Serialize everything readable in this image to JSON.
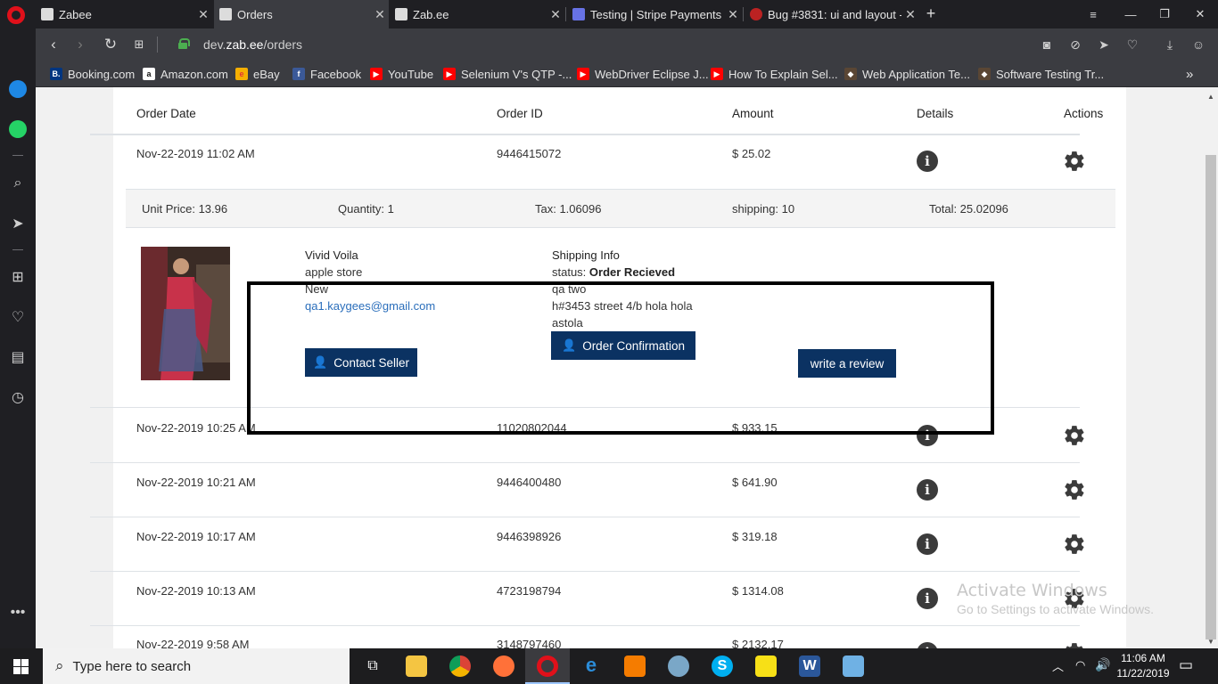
{
  "browser": {
    "tabs": [
      {
        "title": "Zabee",
        "active": false
      },
      {
        "title": "Orders",
        "active": true
      },
      {
        "title": "Zab.ee",
        "active": false
      },
      {
        "title": "Testing | Stripe Payments",
        "active": false
      },
      {
        "title": "Bug #3831: ui and layout -",
        "active": false
      }
    ],
    "new_tab": "+",
    "url_prefix": "dev.",
    "url_domain": "zab.ee",
    "url_path": "/orders",
    "bookmarks": [
      {
        "label": "Booking.com",
        "icon": "B.",
        "color": "#003580"
      },
      {
        "label": "Amazon.com",
        "icon": "a",
        "color": "#111111"
      },
      {
        "label": "eBay",
        "icon": "e",
        "color": "#e53238"
      },
      {
        "label": "Facebook",
        "icon": "f",
        "color": "#3b5998"
      },
      {
        "label": "YouTube",
        "icon": "▶",
        "color": "#ff0000"
      },
      {
        "label": "Selenium V's QTP -...",
        "icon": "▶",
        "color": "#ff0000"
      },
      {
        "label": "WebDriver Eclipse J...",
        "icon": "▶",
        "color": "#ff0000"
      },
      {
        "label": "How To Explain Sel...",
        "icon": "▶",
        "color": "#ff0000"
      },
      {
        "label": "Web Application Te...",
        "icon": "◆",
        "color": "#5a4634"
      },
      {
        "label": "Software Testing Tr...",
        "icon": "◆",
        "color": "#5a4634"
      }
    ]
  },
  "orders_table": {
    "headers": {
      "date": "Order Date",
      "id": "Order ID",
      "amount": "Amount",
      "details": "Details",
      "actions": "Actions"
    },
    "rows": [
      {
        "date": "Nov-22-2019 11:02 AM",
        "id": "9446415072",
        "amount": "$ 25.02"
      },
      {
        "date": "Nov-22-2019 10:25 AM",
        "id": "11020802044",
        "amount": "$ 933.15"
      },
      {
        "date": "Nov-22-2019 10:21 AM",
        "id": "9446400480",
        "amount": "$ 641.90"
      },
      {
        "date": "Nov-22-2019 10:17 AM",
        "id": "9446398926",
        "amount": "$ 319.18"
      },
      {
        "date": "Nov-22-2019 10:13 AM",
        "id": "4723198794",
        "amount": "$ 1314.08"
      },
      {
        "date": "Nov-22-2019 9:58 AM",
        "id": "3148797460",
        "amount": "$ 2132.17"
      }
    ]
  },
  "order_detail": {
    "unit_price": "Unit Price: 13.96",
    "quantity": "Quantity: 1",
    "tax": "Tax: 1.06096",
    "shipping": "shipping: 10",
    "total": "Total: 25.02096",
    "seller_name": "Vivid Voila",
    "seller_store": "apple store",
    "condition": "New",
    "seller_email": "qa1.kaygees@gmail.com",
    "contact_seller": "Contact Seller",
    "shipping_title": "Shipping Info",
    "status_label": "status:",
    "status_value": "Order Recieved",
    "ship_name": "qa two",
    "ship_address": "h#3453 street 4/b hola hola",
    "ship_city": "astola",
    "order_confirmation": "Order Confirmation",
    "write_review": "write a review"
  },
  "watermark": {
    "line1": "Activate Windows",
    "line2": "Go to Settings to activate Windows."
  },
  "taskbar": {
    "search_placeholder": "Type here to search",
    "time": "11:06 AM",
    "date": "11/22/2019"
  }
}
